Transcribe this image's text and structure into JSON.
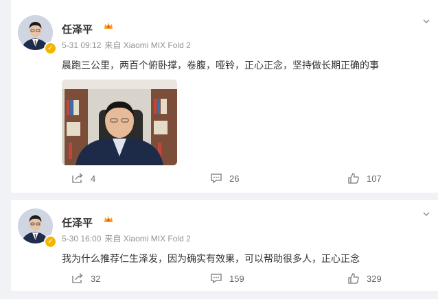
{
  "posts": [
    {
      "author": "任泽平",
      "date": "5-31 09:12",
      "source": "来自 Xiaomi MIX Fold 2",
      "text": "晨跑三公里，两百个俯卧撑，卷腹，哑铃，正心正念，坚持做长期正确的事",
      "reposts": "4",
      "comments": "26",
      "likes": "107"
    },
    {
      "author": "任泽平",
      "date": "5-30 16:00",
      "source": "来自 Xiaomi MIX Fold 2",
      "text": "我为什么推荐仁生泽发，因为确实有效果，可以帮助很多人，正心正念",
      "reposts": "32",
      "comments": "159",
      "likes": "329"
    }
  ],
  "colors": {
    "background": "#f1f2f5",
    "card": "#ffffff",
    "meta": "#939393",
    "verified": "#f5b400"
  },
  "icons": [
    "avatar",
    "verified-icon",
    "crown-icon",
    "chevron-down-icon",
    "share-icon",
    "comment-icon",
    "like-icon"
  ]
}
